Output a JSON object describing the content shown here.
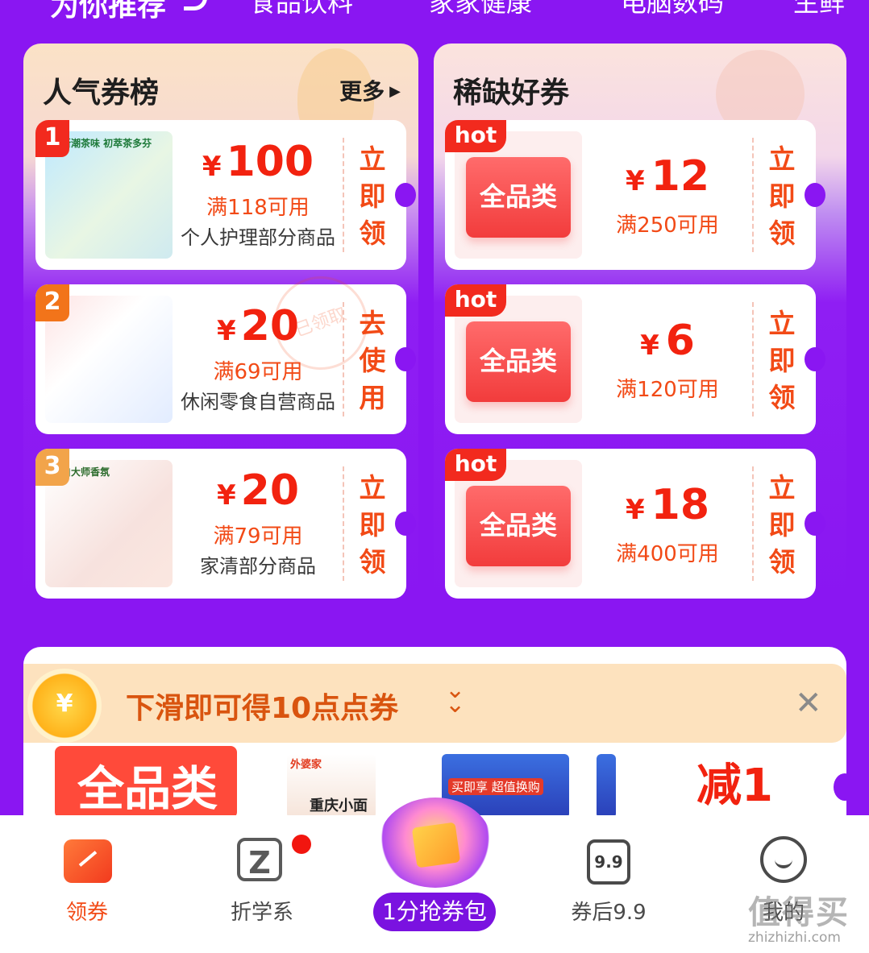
{
  "topnav": {
    "tabs": [
      {
        "label": "为你推荐",
        "active": true
      },
      {
        "label": "食品饮料"
      },
      {
        "label": "家家健康"
      },
      {
        "label": "电脑数码"
      },
      {
        "label": "生鲜"
      }
    ]
  },
  "left_panel": {
    "title": "人气券榜",
    "more_label": "更多",
    "coupons": [
      {
        "rank": "1",
        "amount": "100",
        "currency": "¥",
        "condition": "满118可用",
        "scope": "个人护理部分商品",
        "cta": [
          "立",
          "即",
          "领"
        ],
        "image_caption": "清新潮茶味 初萃茶多芬"
      },
      {
        "rank": "2",
        "amount": "20",
        "currency": "¥",
        "condition": "满69可用",
        "scope": "休闲零食自营商品",
        "cta": [
          "去",
          "使",
          "用"
        ],
        "stamp": "已领取"
      },
      {
        "rank": "3",
        "amount": "20",
        "currency": "¥",
        "condition": "满79可用",
        "scope": "家清部分商品",
        "cta": [
          "立",
          "即",
          "领"
        ],
        "image_caption": "立白大师香氛"
      }
    ]
  },
  "right_panel": {
    "title": "稀缺好券",
    "coupons": [
      {
        "badge": "hot",
        "ticket_label": "全品类",
        "amount": "12",
        "currency": "¥",
        "condition": "满250可用",
        "cta": [
          "立",
          "即",
          "领"
        ]
      },
      {
        "badge": "hot",
        "ticket_label": "全品类",
        "amount": "6",
        "currency": "¥",
        "condition": "满120可用",
        "cta": [
          "立",
          "即",
          "领"
        ]
      },
      {
        "badge": "hot",
        "ticket_label": "全品类",
        "amount": "18",
        "currency": "¥",
        "condition": "满400可用",
        "cta": [
          "立",
          "即",
          "领"
        ]
      }
    ]
  },
  "slide_banner": {
    "coin_symbol": "¥",
    "text": "下滑即可得10点点券",
    "chevron": "⌄"
  },
  "feed": {
    "ticket_label": "全品类",
    "product1_brand": "外婆家",
    "product1_label": "重庆小面",
    "product2_label": "买即享 超值换购",
    "discount_text": "减1"
  },
  "bottom_nav": {
    "items": [
      {
        "label": "领券",
        "active": true
      },
      {
        "label": "折学系"
      },
      {
        "label": "1分抢券包"
      },
      {
        "label": "券后9.9",
        "icon_text": "9.9"
      },
      {
        "label": "我的"
      }
    ]
  },
  "watermark": {
    "line1": "值得买",
    "line2": "zhizhizhi.com"
  },
  "colors": {
    "background": "#8a16f2",
    "accent": "#f24a16",
    "price_red": "#f2220f"
  }
}
